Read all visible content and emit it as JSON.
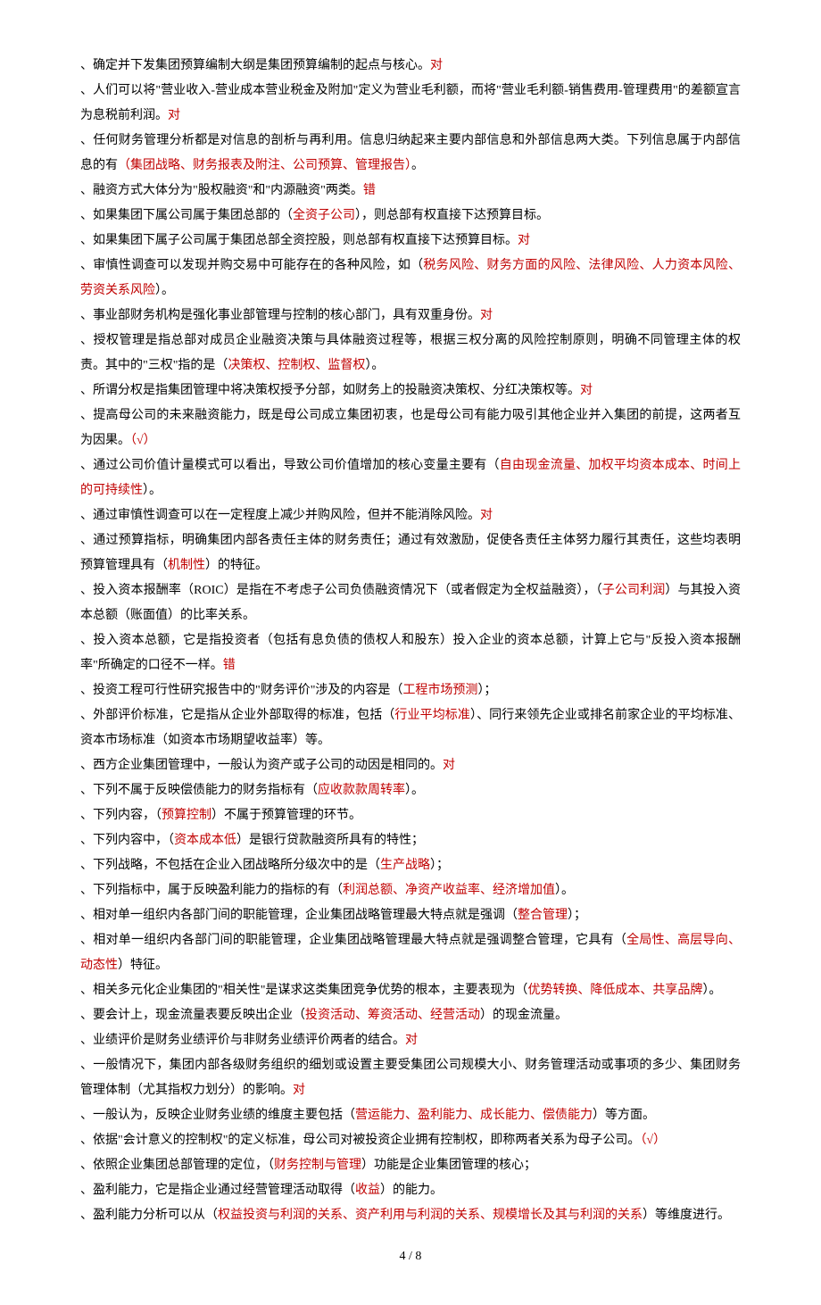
{
  "items": [
    [
      {
        "t": "、确定并下发集团预算编制大纲是集团预算编制的起点与核心。",
        "r": false
      },
      {
        "t": "对",
        "r": true
      }
    ],
    [
      {
        "t": "、人们可以将\"营业收入-营业成本营业税金及附加\"定义为营业毛利额，而将\"营业毛利额-销售费用-管理费用\"的差额宣言为息税前利润。",
        "r": false
      },
      {
        "t": "对",
        "r": true
      }
    ],
    [
      {
        "t": "、任何财务管理分析都是对信息的剖析与再利用。信息归纳起来主要内部信息和外部信息两大类。下列信息属于内部信息的有",
        "r": false
      },
      {
        "t": "（集团战略、财务报表及附注、公司预算、管理报告）",
        "r": true
      },
      {
        "t": "。",
        "r": false
      }
    ],
    [
      {
        "t": "、融资方式大体分为\"股权融资\"和\"内源融资\"两类。",
        "r": false
      },
      {
        "t": "错",
        "r": true
      }
    ],
    [
      {
        "t": "、如果集团下属公司属于集团总部的（",
        "r": false
      },
      {
        "t": "全资子公司",
        "r": true
      },
      {
        "t": "），则总部有权直接下达预算目标。",
        "r": false
      }
    ],
    [
      {
        "t": "、如果集团下属子公司属于集团总部全资控股，则总部有权直接下达预算目标。",
        "r": false
      },
      {
        "t": "对",
        "r": true
      }
    ],
    [
      {
        "t": "、审慎性调查可以发现并购交易中可能存在的各种风险，如（",
        "r": false
      },
      {
        "t": "税务风险、财务方面的风险、法律风险、人力资本风险、劳资关系风险",
        "r": true
      },
      {
        "t": "）。",
        "r": false
      }
    ],
    [
      {
        "t": "、事业部财务机构是强化事业部管理与控制的核心部门，具有双重身份。",
        "r": false
      },
      {
        "t": "对",
        "r": true
      }
    ],
    [
      {
        "t": "、授权管理是指总部对成员企业融资决策与具体融资过程等，根据三权分离的风险控制原则，明确不同管理主体的权责。其中的\"三权\"指的是（",
        "r": false
      },
      {
        "t": "决策权、控制权、监督权",
        "r": true
      },
      {
        "t": "）。",
        "r": false
      }
    ],
    [
      {
        "t": "、所谓分权是指集团管理中将决策权授予分部，如财务上的投融资决策权、分红决策权等。",
        "r": false
      },
      {
        "t": "对",
        "r": true
      }
    ],
    [
      {
        "t": "、提高母公司的未来融资能力，既是母公司成立集团初衷，也是母公司有能力吸引其他企业并入集团的前提，这两者互为因果。",
        "r": false
      },
      {
        "t": "（√）",
        "r": true
      }
    ],
    [
      {
        "t": "、通过公司价值计量模式可以看出，导致公司价值增加的核心变量主要有（",
        "r": false
      },
      {
        "t": "自由现金流量、加权平均资本成本、时间上的可持续性",
        "r": true
      },
      {
        "t": "）。",
        "r": false
      }
    ],
    [
      {
        "t": "、通过审慎性调查可以在一定程度上减少并购风险，但并不能消除风险。",
        "r": false
      },
      {
        "t": "对",
        "r": true
      }
    ],
    [
      {
        "t": "、通过预算指标，明确集团内部各责任主体的财务责任；通过有效激励，促使各责任主体努力履行其责任，这些均表明预算管理具有（",
        "r": false
      },
      {
        "t": "机制性",
        "r": true
      },
      {
        "t": "）的特征。",
        "r": false
      }
    ],
    [
      {
        "t": "、投入资本报酬率（ROIC）是指在不考虑子公司负债融资情况下（或者假定为全权益融资），（",
        "r": false
      },
      {
        "t": "子公司利润",
        "r": true
      },
      {
        "t": "）与其投入资本总额（账面值）的比率关系。",
        "r": false
      }
    ],
    [
      {
        "t": "、投入资本总额，它是指投资者（包括有息负债的债权人和股东）投入企业的资本总额，计算上它与\"反投入资本报酬率\"所确定的口径不一样。",
        "r": false
      },
      {
        "t": "错",
        "r": true
      }
    ],
    [
      {
        "t": "、投资工程可行性研究报告中的\"财务评价\"涉及的内容是（",
        "r": false
      },
      {
        "t": "工程市场预测",
        "r": true
      },
      {
        "t": "）；",
        "r": false
      }
    ],
    [
      {
        "t": "、外部评价标准，它是指从企业外部取得的标准，包括（",
        "r": false
      },
      {
        "t": "行业平均标准",
        "r": true
      },
      {
        "t": "）、同行来领先企业或排名前家企业的平均标准、资本市场标准（如资本市场期望收益率）等。",
        "r": false
      }
    ],
    [
      {
        "t": "、西方企业集团管理中，一般认为资产或子公司的动因是相同的。",
        "r": false
      },
      {
        "t": "对",
        "r": true
      }
    ],
    [
      {
        "t": "、下列不属于反映偿债能力的财务指标有（",
        "r": false
      },
      {
        "t": "应收款款周转率",
        "r": true
      },
      {
        "t": "）。",
        "r": false
      }
    ],
    [
      {
        "t": "、下列内容，（",
        "r": false
      },
      {
        "t": "预算控制",
        "r": true
      },
      {
        "t": "）不属于预算管理的环节。",
        "r": false
      }
    ],
    [
      {
        "t": "、下列内容中，（",
        "r": false
      },
      {
        "t": "资本成本低",
        "r": true
      },
      {
        "t": "）是银行贷款融资所具有的特性；",
        "r": false
      }
    ],
    [
      {
        "t": "、下列战略，不包括在企业入团战略所分级次中的是（",
        "r": false
      },
      {
        "t": "生产战略",
        "r": true
      },
      {
        "t": "）；",
        "r": false
      }
    ],
    [
      {
        "t": "、下列指标中，属于反映盈利能力的指标的有（",
        "r": false
      },
      {
        "t": "利润总额、净资产收益率、经济增加值",
        "r": true
      },
      {
        "t": "）。",
        "r": false
      }
    ],
    [
      {
        "t": "、相对单一组织内各部门间的职能管理，企业集团战略管理最大特点就是强调（",
        "r": false
      },
      {
        "t": "整合管理",
        "r": true
      },
      {
        "t": "）；",
        "r": false
      }
    ],
    [
      {
        "t": "、相对单一组织内各部门间的职能管理，企业集团战略管理最大特点就是强调整合管理，它具有（",
        "r": false
      },
      {
        "t": "全局性、高层导向、动态性",
        "r": true
      },
      {
        "t": "）特征。",
        "r": false
      }
    ],
    [
      {
        "t": "、相关多元化企业集团的\"相关性\"是谋求这类集团竞争优势的根本，主要表现为（",
        "r": false
      },
      {
        "t": "优势转换、降低成本、共享品牌",
        "r": true
      },
      {
        "t": "）。",
        "r": false
      }
    ],
    [
      {
        "t": "、要会计上，现金流量表要反映出企业（",
        "r": false
      },
      {
        "t": "投资活动、筹资活动、经营活动",
        "r": true
      },
      {
        "t": "）的现金流量。",
        "r": false
      }
    ],
    [
      {
        "t": "、业绩评价是财务业绩评价与非财务业绩评价两者的结合。",
        "r": false
      },
      {
        "t": "对",
        "r": true
      }
    ],
    [
      {
        "t": "、一般情况下，集团内部各级财务组织的细划或设置主要受集团公司规模大小、财务管理活动或事项的多少、集团财务管理体制（尤其指权力划分）的影响。",
        "r": false
      },
      {
        "t": "对",
        "r": true
      }
    ],
    [
      {
        "t": "、一般认为，反映企业财务业绩的维度主要包括（",
        "r": false
      },
      {
        "t": "营运能力、盈利能力、成长能力、偿债能力",
        "r": true
      },
      {
        "t": "）等方面。",
        "r": false
      }
    ],
    [
      {
        "t": "、依据\"会计意义的控制权\"的定义标准，母公司对被投资企业拥有控制权，即称两者关系为母子公司。",
        "r": false
      },
      {
        "t": "（√）",
        "r": true
      }
    ],
    [
      {
        "t": "、依照企业集团总部管理的定位，（",
        "r": false
      },
      {
        "t": "财务控制与管理",
        "r": true
      },
      {
        "t": "）功能是企业集团管理的核心；",
        "r": false
      }
    ],
    [
      {
        "t": "、盈利能力，它是指企业通过经营管理活动取得（",
        "r": false
      },
      {
        "t": "收益",
        "r": true
      },
      {
        "t": "）的能力。",
        "r": false
      }
    ],
    [
      {
        "t": "、盈利能力分析可以从（",
        "r": false
      },
      {
        "t": "权益投资与利润的关系、资产利用与利润的关系、规模增长及其与利润的关系",
        "r": true
      },
      {
        "t": "）等维度进行。",
        "r": false
      }
    ]
  ],
  "pageNum": "4 / 8"
}
